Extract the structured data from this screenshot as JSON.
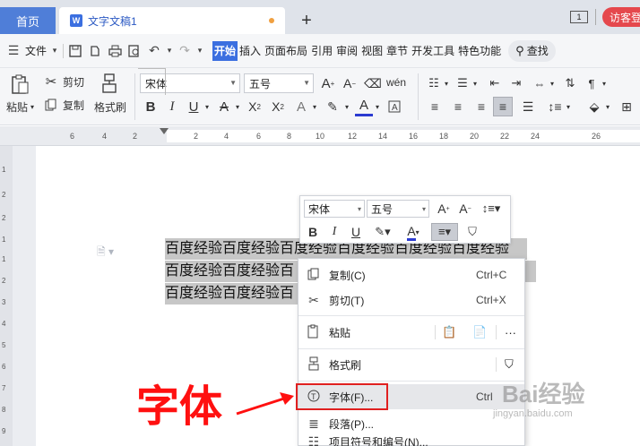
{
  "tabs": {
    "home": "首页",
    "doc": "文字文稿1",
    "add": "+",
    "guest": "访客登"
  },
  "menubar": {
    "file": "文件",
    "items": [
      "开始",
      "插入",
      "页面布局",
      "引用",
      "审阅",
      "视图",
      "章节",
      "开发工具",
      "特色功能"
    ],
    "search": "查找"
  },
  "ribbon": {
    "paste": "粘贴",
    "cut": "剪切",
    "copy": "复制",
    "format_painter": "格式刷",
    "font": "宋体",
    "size": "五号"
  },
  "ruler": [
    "6",
    "4",
    "2",
    "2",
    "4",
    "6",
    "8",
    "10",
    "12",
    "14",
    "16",
    "18",
    "20",
    "22",
    "24",
    "26"
  ],
  "vruler": [
    "1",
    "2",
    "2",
    "1",
    "1",
    "2",
    "3",
    "4",
    "5",
    "6",
    "7",
    "8",
    "9"
  ],
  "document": {
    "lines": [
      "百度经验百度经验百度经验百度经验百度经验百度经验",
      "百度经验百度经验百",
      "百度经验百度经验百"
    ]
  },
  "minibar": {
    "font": "宋体",
    "size": "五号"
  },
  "context_menu": {
    "copy": "复制(C)",
    "copy_sc": "Ctrl+C",
    "cut": "剪切(T)",
    "cut_sc": "Ctrl+X",
    "paste": "粘贴",
    "painter": "格式刷",
    "font": "字体(F)...",
    "font_sc": "Ctrl",
    "para": "段落(P)...",
    "bullets": "项目符号和编号(N)..."
  },
  "annotation": "字体",
  "watermark": {
    "main": "Bai经验",
    "url": "jingyan.baidu.com"
  },
  "colors": {
    "accent": "#3b6fe0",
    "annotation": "#ff1010",
    "selection": "#c7c7c7"
  }
}
